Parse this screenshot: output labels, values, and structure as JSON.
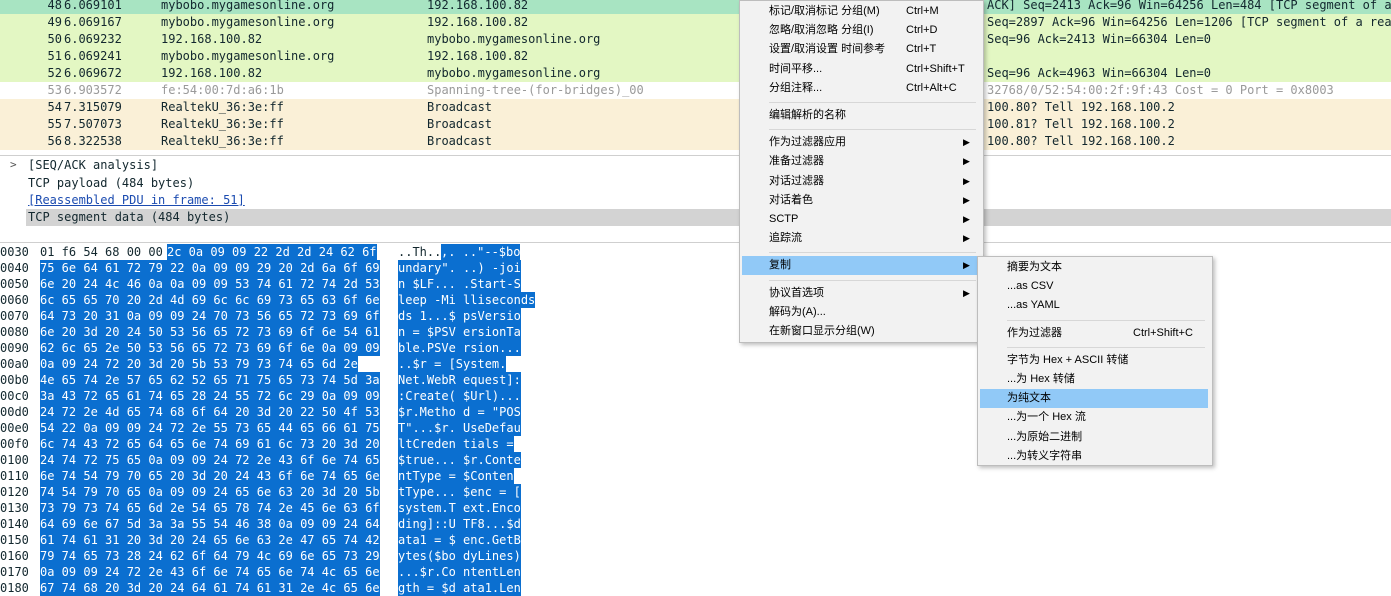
{
  "packets": [
    {
      "no": "48",
      "time": "6.069101",
      "src": "mybobo.mygamesonline.org",
      "dst": "192.168.100.82",
      "info": "ACK] Seq=2413 Ack=96 Win=64256 Len=484 [TCP segment of a r",
      "bg": "#a8e4c2",
      "color": "#12272e"
    },
    {
      "no": "49",
      "time": "6.069167",
      "src": "mybobo.mygamesonline.org",
      "dst": "192.168.100.82",
      "info": "Seq=2897 Ack=96 Win=64256 Len=1206 [TCP segment of a reass",
      "bg": "#e3f7c3",
      "color": "#12272e"
    },
    {
      "no": "50",
      "time": "6.069232",
      "src": "192.168.100.82",
      "dst": "mybobo.mygamesonline.org",
      "info": "Seq=96 Ack=2413 Win=66304 Len=0",
      "bg": "#e3f7c3",
      "color": "#12272e"
    },
    {
      "no": "51",
      "time": "6.069241",
      "src": "mybobo.mygamesonline.org",
      "dst": "192.168.100.82",
      "info": "",
      "bg": "#e3f7c3",
      "color": "#12272e"
    },
    {
      "no": "52",
      "time": "6.069672",
      "src": "192.168.100.82",
      "dst": "mybobo.mygamesonline.org",
      "info": "Seq=96 Ack=4963 Win=66304 Len=0",
      "bg": "#e3f7c3",
      "color": "#12272e"
    },
    {
      "no": "53",
      "time": "6.903572",
      "src": "fe:54:00:7d:a6:1b",
      "dst": "Spanning-tree-(for-bridges)_00",
      "info": "32768/0/52:54:00:2f:9f:43  Cost = 0  Port = 0x8003",
      "bg": "#ffffff",
      "color": "#9a9a9a"
    },
    {
      "no": "54",
      "time": "7.315079",
      "src": "RealtekU_36:3e:ff",
      "dst": "Broadcast",
      "info": "100.80? Tell 192.168.100.2",
      "bg": "#faf0d7",
      "color": "#12272e"
    },
    {
      "no": "55",
      "time": "7.507073",
      "src": "RealtekU_36:3e:ff",
      "dst": "Broadcast",
      "info": "100.81? Tell 192.168.100.2",
      "bg": "#faf0d7",
      "color": "#12272e"
    },
    {
      "no": "56",
      "time": "8.322538",
      "src": "RealtekU_36:3e:ff",
      "dst": "Broadcast",
      "info": "100.80? Tell 192.168.100.2",
      "bg": "#faf0d7",
      "color": "#12272e"
    }
  ],
  "detail": {
    "arrow": ">",
    "lines": [
      "[SEQ/ACK analysis]",
      "TCP payload (484 bytes)",
      "[Reassembled PDU in frame: 51]",
      "TCP segment data (484 bytes)"
    ]
  },
  "bytes": [
    {
      "off": "0030",
      "hex_plain": "01 f6 54 68 00 00",
      "hex_hl": "2c 0a  09 09 22 2d 2d 24 62 6f",
      "asc_plain": "..Th..",
      "asc_hl": ",. ..\"--$bo"
    },
    {
      "off": "0040",
      "hex_plain": "",
      "hex_hl": "75 6e 64 61 72 79 22 0a  09 09 29 20 2d 6a 6f 69",
      "asc_plain": "",
      "asc_hl": "undary\". ..) -joi"
    },
    {
      "off": "0050",
      "hex_plain": "",
      "hex_hl": "6e 20 24 4c 46 0a 0a 09  09 53 74 61 72 74 2d 53",
      "asc_plain": "",
      "asc_hl": "n $LF... .Start-S"
    },
    {
      "off": "0060",
      "hex_plain": "",
      "hex_hl": "6c 65 65 70 20 2d 4d 69  6c 6c 69 73 65 63 6f 6e",
      "asc_plain": "",
      "asc_hl": "leep -Mi lliseconds"
    },
    {
      "off": "0070",
      "hex_plain": "",
      "hex_hl": "64 73 20 31 0a 09 09 24  70 73 56 65 72 73 69 6f",
      "asc_plain": "",
      "asc_hl": "ds 1...$ psVersio"
    },
    {
      "off": "0080",
      "hex_plain": "",
      "hex_hl": "6e 20 3d 20 24 50 53 56  65 72 73 69 6f 6e 54 61",
      "asc_plain": "",
      "asc_hl": "n = $PSV ersionTa"
    },
    {
      "off": "0090",
      "hex_plain": "",
      "hex_hl": "62 6c 65 2e 50 53 56 65  72 73 69 6f 6e 0a 09 09",
      "asc_plain": "",
      "asc_hl": "ble.PSVe rsion..."
    },
    {
      "off": "00a0",
      "hex_plain": "",
      "hex_hl": "0a 09 24 72 20 3d 20  5b 53 79 73 74 65 6d 2e",
      "asc_plain": "",
      "asc_hl": "..$r =  [System."
    },
    {
      "off": "00b0",
      "hex_plain": "",
      "hex_hl": "4e 65 74 2e 57 65 62 52  65 71 75 65 73 74 5d 3a",
      "asc_plain": "",
      "asc_hl": "Net.WebR equest]:"
    },
    {
      "off": "00c0",
      "hex_plain": "",
      "hex_hl": "3a 43 72 65 61 74 65 28  24 55 72 6c 29 0a 09 09",
      "asc_plain": "",
      "asc_hl": ":Create( $Url)..."
    },
    {
      "off": "00d0",
      "hex_plain": "",
      "hex_hl": "24 72 2e 4d 65 74 68 6f  64 20 3d 20 22 50 4f 53",
      "asc_plain": "",
      "asc_hl": "$r.Metho d = \"POS"
    },
    {
      "off": "00e0",
      "hex_plain": "",
      "hex_hl": "54 22 0a 09 09 24 72 2e  55 73 65 44 65 66 61 75",
      "asc_plain": "",
      "asc_hl": "T\"...$r. UseDefau"
    },
    {
      "off": "00f0",
      "hex_plain": "",
      "hex_hl": "6c 74 43 72 65 64 65 6e  74 69 61 6c 73 20 3d 20",
      "asc_plain": "",
      "asc_hl": "ltCreden tials = "
    },
    {
      "off": "0100",
      "hex_plain": "",
      "hex_hl": "24 74 72 75 65 0a 09 09  24 72 2e 43 6f 6e 74 65",
      "asc_plain": "",
      "asc_hl": "$true... $r.Conte"
    },
    {
      "off": "0110",
      "hex_plain": "",
      "hex_hl": "6e 74 54 79 70 65 20 3d  20 24 43 6f 6e 74 65 6e",
      "asc_plain": "",
      "asc_hl": "ntType =  $Conten"
    },
    {
      "off": "0120",
      "hex_plain": "",
      "hex_hl": "74 54 79 70 65 0a 09 09  24 65 6e 63 20 3d 20 5b",
      "asc_plain": "",
      "asc_hl": "tType... $enc = ["
    },
    {
      "off": "0130",
      "hex_plain": "",
      "hex_hl": "73 79 73 74 65 6d 2e 54  65 78 74 2e 45 6e 63 6f",
      "asc_plain": "",
      "asc_hl": "system.T ext.Enco"
    },
    {
      "off": "0140",
      "hex_plain": "",
      "hex_hl": "64 69 6e 67 5d 3a 3a 55  54 46 38 0a 09 09 24 64",
      "asc_plain": "",
      "asc_hl": "ding]::U TF8...$d"
    },
    {
      "off": "0150",
      "hex_plain": "",
      "hex_hl": "61 74 61 31 20 3d 20 24  65 6e 63 2e 47 65 74 42",
      "asc_plain": "",
      "asc_hl": "ata1 = $ enc.GetB"
    },
    {
      "off": "0160",
      "hex_plain": "",
      "hex_hl": "79 74 65 73 28 24 62 6f  64 79 4c 69 6e 65 73 29",
      "asc_plain": "",
      "asc_hl": "ytes($bo dyLines)"
    },
    {
      "off": "0170",
      "hex_plain": "",
      "hex_hl": "0a 09 09 24 72 2e 43 6f  6e 74 65 6e 74 4c 65 6e",
      "asc_plain": "",
      "asc_hl": "...$r.Co ntentLen"
    },
    {
      "off": "0180",
      "hex_plain": "",
      "hex_hl": "67 74 68 20 3d 20 24 64  61 74 61 31 2e 4c 65 6e",
      "asc_plain": "",
      "asc_hl": "gth = $d ata1.Len"
    }
  ],
  "context_menu": {
    "items": [
      {
        "type": "item",
        "label": "标记/取消标记 分组(M)",
        "shortcut": "Ctrl+M"
      },
      {
        "type": "item",
        "label": "忽略/取消忽略 分组(I)",
        "shortcut": "Ctrl+D"
      },
      {
        "type": "item",
        "label": "设置/取消设置 时间参考",
        "shortcut": "Ctrl+T"
      },
      {
        "type": "item",
        "label": "时间平移...",
        "shortcut": "Ctrl+Shift+T"
      },
      {
        "type": "item",
        "label": "分组注释...",
        "shortcut": "Ctrl+Alt+C"
      },
      {
        "type": "sep"
      },
      {
        "type": "item",
        "label": "编辑解析的名称"
      },
      {
        "type": "sep"
      },
      {
        "type": "sub",
        "label": "作为过滤器应用"
      },
      {
        "type": "sub",
        "label": "准备过滤器"
      },
      {
        "type": "sub",
        "label": "对话过滤器"
      },
      {
        "type": "sub",
        "label": "对话着色"
      },
      {
        "type": "sub",
        "label": "SCTP"
      },
      {
        "type": "sub",
        "label": "追踪流"
      },
      {
        "type": "sep"
      },
      {
        "type": "sub",
        "label": "复制",
        "highlight": true
      },
      {
        "type": "sep"
      },
      {
        "type": "sub",
        "label": "协议首选项"
      },
      {
        "type": "item",
        "label": "解码为(A)..."
      },
      {
        "type": "item",
        "label": "在新窗口显示分组(W)"
      }
    ]
  },
  "copy_submenu": {
    "items": [
      {
        "type": "item",
        "label": "摘要为文本"
      },
      {
        "type": "item",
        "label": "...as CSV"
      },
      {
        "type": "item",
        "label": "...as YAML"
      },
      {
        "type": "sep"
      },
      {
        "type": "item",
        "label": "作为过滤器",
        "shortcut": "Ctrl+Shift+C"
      },
      {
        "type": "sep"
      },
      {
        "type": "item",
        "label": "字节为 Hex + ASCII 转储"
      },
      {
        "type": "item",
        "label": "...为 Hex 转储"
      },
      {
        "type": "item",
        "label": "为纯文本",
        "highlight": true
      },
      {
        "type": "item",
        "label": "...为一个 Hex 流"
      },
      {
        "type": "item",
        "label": "...为原始二进制"
      },
      {
        "type": "item",
        "label": "...为转义字符串"
      }
    ]
  }
}
